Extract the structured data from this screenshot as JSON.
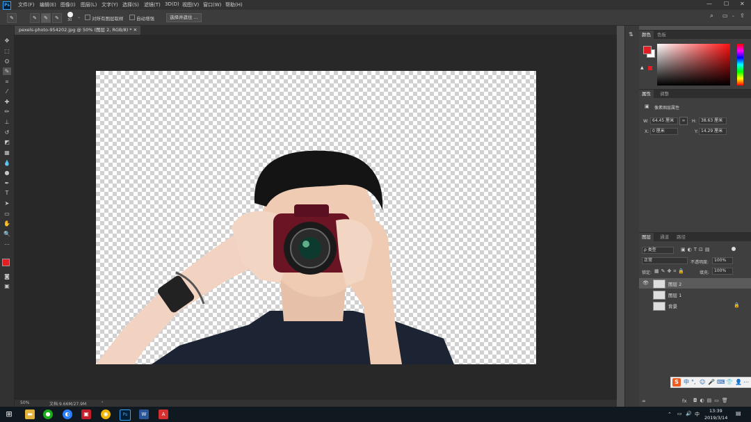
{
  "app": {
    "logo": "Ps",
    "title": "Adobe Photoshop"
  },
  "menu": [
    "文件(F)",
    "编辑(E)",
    "图像(I)",
    "图层(L)",
    "文字(Y)",
    "选择(S)",
    "滤镜(T)",
    "3D(D)",
    "视图(V)",
    "窗口(W)",
    "帮助(H)"
  ],
  "window_controls": {
    "min": "—",
    "max": "☐",
    "close": "✕"
  },
  "options": {
    "brush_size": "30",
    "sample_all_layers": "对所有图层取样",
    "auto_enhance": "自动增强",
    "select_mask": "选择并遮住 ..."
  },
  "document": {
    "tab": "pexels-photo-954202.jpg @ 50% (图层 2, RGB/8) *  ✕",
    "zoom": "50%",
    "doc_size": "文档:9.66M/27.9M"
  },
  "color_panel": {
    "tabs": [
      "颜色",
      "色板"
    ],
    "fg_color": "#e01e24",
    "bg_color": "#ffffff"
  },
  "properties_panel": {
    "tabs": [
      "属性",
      "调整"
    ],
    "title": "像素图层属性",
    "w_label": "W:",
    "w_value": "64.45 厘米",
    "h_label": "H:",
    "h_value": "38.63 厘米",
    "x_label": "X:",
    "x_value": "0 厘米",
    "y_label": "Y:",
    "y_value": "14.29 厘米"
  },
  "layers_panel": {
    "tabs": [
      "图层",
      "通道",
      "路径"
    ],
    "filter_kind": "ρ 类型",
    "blend_mode": "正常",
    "opacity_label": "不透明度:",
    "opacity": "100%",
    "lock_label": "锁定:",
    "fill_label": "填充:",
    "fill": "100%",
    "layers": [
      {
        "name": "图层 2",
        "visible": true,
        "selected": true
      },
      {
        "name": "图层 1",
        "visible": false,
        "selected": false
      },
      {
        "name": "背景",
        "visible": false,
        "selected": false
      }
    ],
    "footer_fx": "fx"
  },
  "ime": {
    "logo": "S",
    "items": [
      "中",
      "°,",
      "☺",
      "🎤",
      "⌨",
      "👕",
      "👤",
      "⋯"
    ]
  },
  "taskbar": {
    "ime_lang": "中",
    "time": "13:39",
    "date": "2019/3/14"
  }
}
